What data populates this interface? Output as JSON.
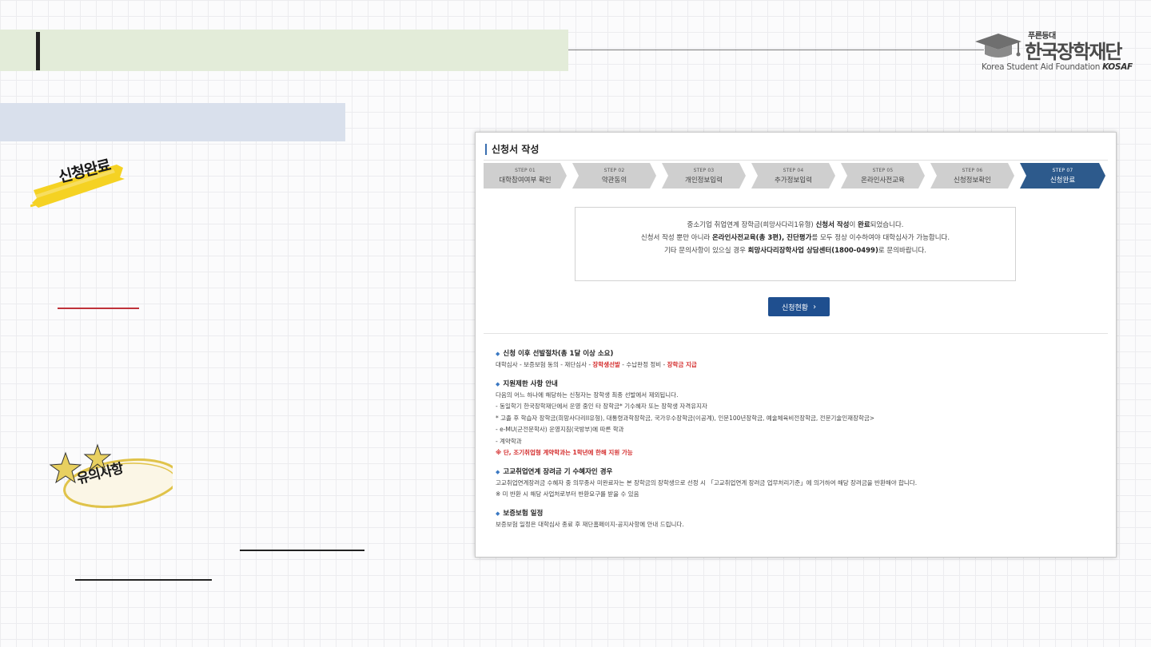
{
  "logo": {
    "tagline": "푸른등대",
    "name": "한국장학재단",
    "foundation": "Korea Student Aid Foundation",
    "abbr": "KOSAF"
  },
  "decor": {
    "tape_label": "신청완료",
    "caution_label": "유의사항",
    "tape_color": "#f5d223",
    "ring_color": "#e0c34a",
    "underline_color": "#c0323a"
  },
  "screen": {
    "title": "신청서 작성",
    "steps": [
      {
        "num": "STEP 01",
        "label": "대학참여여부 확인",
        "active": false
      },
      {
        "num": "STEP 02",
        "label": "약관동의",
        "active": false
      },
      {
        "num": "STEP 03",
        "label": "개인정보입력",
        "active": false
      },
      {
        "num": "STEP 04",
        "label": "추가정보입력",
        "active": false
      },
      {
        "num": "STEP 05",
        "label": "온라인사전교육",
        "active": false
      },
      {
        "num": "STEP 06",
        "label": "신청정보확인",
        "active": false
      },
      {
        "num": "STEP 07",
        "label": "신청완료",
        "active": true
      }
    ],
    "step_active_color": "#2d5a8c",
    "step_inactive_color": "#cfcfcf",
    "notice": {
      "l1_a": "중소기업 취업연계 장학금(희망사다리1유형) ",
      "l1_b": "신청서 작성",
      "l1_c": "이 ",
      "l1_d": "완료",
      "l1_e": "되었습니다.",
      "l2_a": "신청서 작성 뿐만 아니라 ",
      "l2_b": "온라인사전교육(총 3편), 진단평가",
      "l2_c": "를 모두 정상 이수하여야 대학심사가 가능합니다.",
      "l3_a": "기타 문의사항이 있으실 경우 ",
      "l3_b": "희망사다리장학사업 상담센터(1800-0499)",
      "l3_c": "로 문의바랍니다."
    },
    "status_button": "신청현황",
    "status_button_chevron": "›",
    "sections": {
      "s1": {
        "bullet": "◆",
        "heading": "신청 이후 선발절차(총 1달 이상 소요)",
        "line_a": "대학심사 - 보증보험 동의 - 재단심사 - ",
        "line_b": "장학생선발",
        "line_c": " - 수납완정 정비 - ",
        "line_d": "장학금 지급"
      },
      "s2": {
        "bullet": "◆",
        "heading": "지원제한 사항 안내",
        "l1": "다음의 어느 하나에 해당하는 신청자는 장학생 최종 선발에서 제외됩니다.",
        "l2": "- 동일학기 한국장학재단에서 운영 중인 타 장학금* 기수혜자 또는 장학생 자격유지자",
        "l3": "* 고졸 후 학습자 장학금(희망사다리II유형), 대통령과학장학금, 국가우수장학금(이공계), 인문100년장학금, 예술체육비전장학금, 전문기술인재장학금>",
        "l4": "- e-MU(군전문학사) 운영지침(국방부)에 따른 학과",
        "l5": "- 계약학과",
        "l6": "※ 단, 조기취업형 계약학과는 1학년에 한해 지원 가능"
      },
      "s3": {
        "bullet": "◆",
        "heading": "고교취업연계 장려금 기 수혜자인 경우",
        "l1": "고교취업연계장려금 수혜자 중 의무종사 미완료자는 본 장학금의 장학생으로 선정 시 「고교취업연계 장려금 업무처리기준」에 의거하여 해당 장려금을 반환해야 합니다.",
        "l2": "※ 미 반환 시 해당 사업처로부터 반환요구를 받을 수 있음"
      },
      "s4": {
        "bullet": "◆",
        "heading": "보증보험 일정",
        "l1": "보증보험 일정은 대학심사 종료 후 재단홈페이지-공지사항에 안내 드립니다."
      }
    }
  }
}
